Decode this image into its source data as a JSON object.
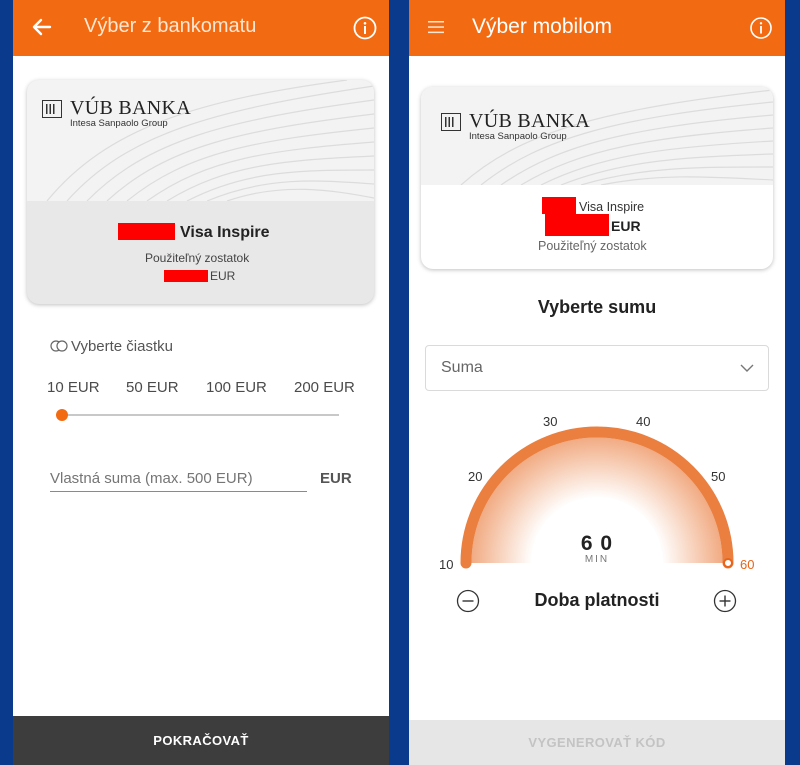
{
  "left": {
    "header": {
      "title": "Výber z bankomatu"
    },
    "card": {
      "bank_name": "VÚB BANKA",
      "bank_group": "Intesa Sanpaolo Group",
      "card_name": "Visa Inspire",
      "balance_label": "Použiteľný zostatok",
      "currency": "EUR"
    },
    "amount_section": {
      "label": "Vyberte čiastku",
      "options": [
        "10 EUR",
        "50 EUR",
        "100 EUR",
        "200 EUR"
      ],
      "selected_index": 0
    },
    "custom_amount": {
      "placeholder": "Vlastná suma (max. 500 EUR)",
      "currency": "EUR"
    },
    "continue_button": "POKRAČOVAŤ"
  },
  "right": {
    "header": {
      "title": "Výber mobilom"
    },
    "card": {
      "bank_name": "VÚB BANKA",
      "bank_group": "Intesa Sanpaolo Group",
      "card_name": "Visa Inspire",
      "currency": "EUR",
      "balance_label": "Použiteľný zostatok"
    },
    "select_label": "Vyberte sumu",
    "amount_select": {
      "placeholder": "Suma"
    },
    "validity_gauge": {
      "ticks": [
        "10",
        "20",
        "30",
        "40",
        "50",
        "60"
      ],
      "min": 10,
      "max": 60,
      "value": 60,
      "value_display": "6 0",
      "unit": "MIN",
      "caption": "Doba platnosti"
    },
    "generate_button": "VYGENEROVAŤ KÓD"
  },
  "colors": {
    "brand_orange": "#f26b12",
    "background_blue": "#0a3a8c",
    "dark_button": "#3d3d3d",
    "disabled_button": "#e6e6e6",
    "redaction": "#ff0000"
  }
}
